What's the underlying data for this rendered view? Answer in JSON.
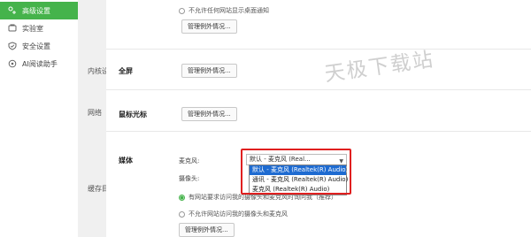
{
  "sidebar": {
    "items": [
      {
        "label": "高级设置",
        "icon": "advanced-settings-icon",
        "active": true
      },
      {
        "label": "实验室",
        "icon": "lab-icon",
        "active": false
      },
      {
        "label": "安全设置",
        "icon": "shield-icon",
        "active": false
      },
      {
        "label": "AI阅读助手",
        "icon": "ai-reader-icon",
        "active": false
      }
    ]
  },
  "strip": {
    "labels": [
      "内核设",
      "网络",
      "缓存目"
    ]
  },
  "top": {
    "radio_label": "不允许任何网站显示桌面通知",
    "exceptions_button": "管理例外情况..."
  },
  "fullscreen": {
    "title": "全屏",
    "exceptions_button": "管理例外情况..."
  },
  "cursor": {
    "title": "鼠标光标",
    "exceptions_button": "管理例外情况..."
  },
  "media": {
    "title": "媒体",
    "mic_label": "麦克风:",
    "camera_label": "摄像头:",
    "mic_selected": "默认 - 麦克风 (Real...",
    "mic_options": [
      "默认 - 麦克风 (Realtek(R) Audio)",
      "通讯 - 麦克风 (Realtek(R) Audio)",
      "麦克风 (Realtek(R) Audio)"
    ],
    "radio_allow_ask": "有网站要求访问我的摄像头和麦克风时询问我（推荐）",
    "radio_deny": "不允许网站访问我的摄像头和麦克风",
    "exceptions_button": "管理例外情况..."
  },
  "watermark": "天极下载站",
  "colors": {
    "accent": "#45b34b",
    "dropdown_selected": "#1e6bd1",
    "highlight_border": "#e02020"
  }
}
